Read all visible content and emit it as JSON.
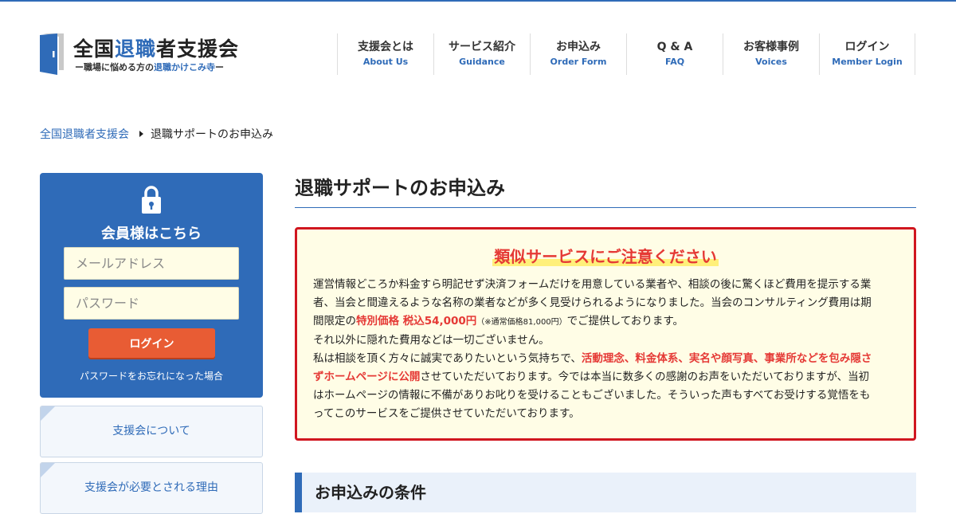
{
  "logo": {
    "title_pre": "全国",
    "title_hl": "退職",
    "title_post": "者支援会",
    "sub_pre": "ー職場に悩める方の",
    "sub_hl": "退職かけこみ寺",
    "sub_post": "ー"
  },
  "nav": [
    {
      "jp": "支援会とは",
      "en": "About Us"
    },
    {
      "jp": "サービス紹介",
      "en": "Guidance"
    },
    {
      "jp": "お申込み",
      "en": "Order Form"
    },
    {
      "jp": "Q & A",
      "en": "FAQ"
    },
    {
      "jp": "お客様事例",
      "en": "Voices"
    },
    {
      "jp": "ログイン",
      "en": "Member Login"
    }
  ],
  "breadcrumb": {
    "home": "全国退職者支援会",
    "current": "退職サポートのお申込み"
  },
  "sidebar": {
    "login_title": "会員様はこちら",
    "email_placeholder": "メールアドレス",
    "password_placeholder": "パスワード",
    "login_button": "ログイン",
    "forgot": "パスワードをお忘れになった場合",
    "links": [
      "支援会について",
      "支援会が必要とされる理由"
    ]
  },
  "main": {
    "title": "退職サポートのお申込み",
    "warning": {
      "title": "類似サービスにご注意ください",
      "p1_a": "運営情報どころか料金すら明記せず決済フォームだけを用意している業者や、相談の後に驚くほど費用を提示する業者、当会と間違えるような名称の業者などが多く見受けられるようになりました。当会のコンサルティング費用は期間限定の",
      "p1_red": "特別価格 税込54,000円",
      "p1_small": "（※通常価格81,000円）",
      "p1_b": "でご提供しております。",
      "p2": "それ以外に隠れた費用などは一切ございません。",
      "p3_a": "私は相談を頂く方々に誠実でありたいという気持ちで、",
      "p3_red": "活動理念、料金体系、実名や顔写真、事業所などを包み隠さずホームページに公開",
      "p3_b": "させていただいております。今では本当に数多くの感謝のお声をいただいておりますが、当初はホームページの情報に不備がありお叱りを受けることもございました。そういった声もすべてお受けする覚悟をもってこのサービスをご提供させていただいております。"
    },
    "section_title": "お申込みの条件"
  },
  "colors": {
    "accent": "#2f6bb8",
    "warning_red": "#e53935",
    "warning_border": "#d0161f",
    "login_button": "#e85c34",
    "warning_bg": "#fffde6"
  }
}
